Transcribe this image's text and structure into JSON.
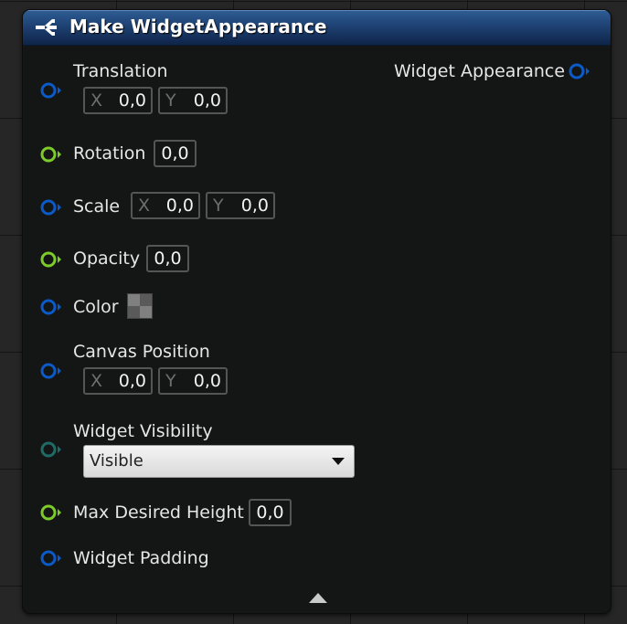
{
  "node": {
    "title": "Make WidgetAppearance",
    "icon": "make-struct-icon",
    "output_pin": {
      "label": "Widget Appearance",
      "color": "#0b5ac8"
    }
  },
  "colors": {
    "vector_pin": "#0b5ac8",
    "float_pin": "#7ccb2a",
    "enum_pin": "#1f6b66",
    "header_top": "#2f5d94",
    "header_bottom": "#0f2448"
  },
  "inputs": {
    "translation": {
      "label": "Translation",
      "x_axis": "X",
      "x_value": "0,0",
      "y_axis": "Y",
      "y_value": "0,0"
    },
    "rotation": {
      "label": "Rotation",
      "value": "0,0"
    },
    "scale": {
      "label": "Scale",
      "x_axis": "X",
      "x_value": "0,0",
      "y_axis": "Y",
      "y_value": "0,0"
    },
    "opacity": {
      "label": "Opacity",
      "value": "0,0"
    },
    "color": {
      "label": "Color"
    },
    "canvas_position": {
      "label": "Canvas Position",
      "x_axis": "X",
      "x_value": "0,0",
      "y_axis": "Y",
      "y_value": "0,0"
    },
    "widget_visibility": {
      "label": "Widget Visibility",
      "selected": "Visible"
    },
    "max_desired_height": {
      "label": "Max Desired Height",
      "value": "0,0"
    },
    "widget_padding": {
      "label": "Widget Padding"
    }
  }
}
